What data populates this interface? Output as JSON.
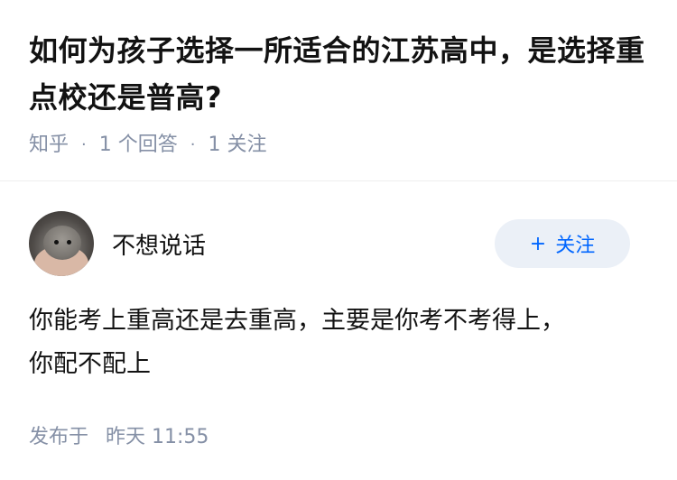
{
  "question": {
    "title": "如何为孩子选择一所适合的江苏高中，是选择重点校还是普高?",
    "source": "知乎",
    "answer_count": "1 个回答",
    "follower_count": "1 关注",
    "separator": "·"
  },
  "answer": {
    "author_name": "不想说话",
    "follow_label": "关注",
    "follow_icon": "+",
    "content_line1": "你能考上重高还是去重高，主要是你考不考得上，",
    "content_line2": "你配不配上",
    "publish_prefix": "发布于",
    "publish_time": "昨天 11:55"
  },
  "colors": {
    "text": "#121212",
    "meta": "#8590a6",
    "accent": "#0066ff",
    "button_bg": "#ebf0f7"
  }
}
